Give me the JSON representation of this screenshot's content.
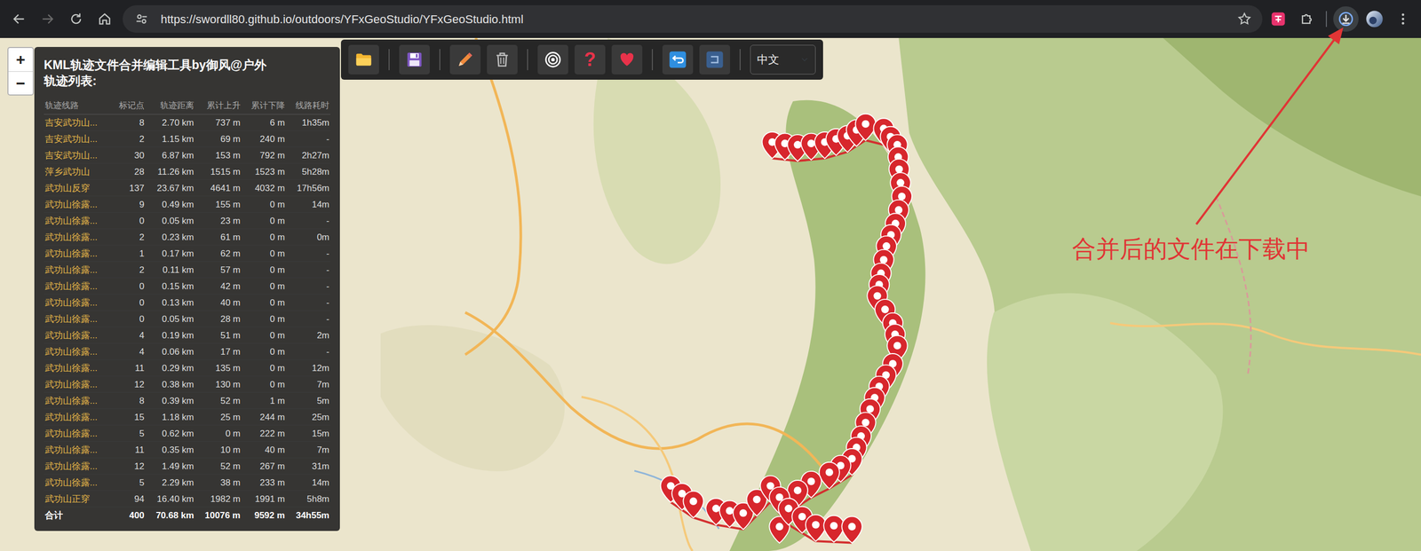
{
  "browser": {
    "url": "https://swordll80.github.io/outdoors/YFxGeoStudio/YFxGeoStudio.html",
    "forward": {
      "disabled": true
    }
  },
  "zoom": {
    "zoom_in": "+",
    "zoom_out": "−"
  },
  "toolbar": {
    "help": "?",
    "language": "中文"
  },
  "panel": {
    "title": "KML轨迹文件合并编辑工具by御风@户外",
    "list_label": "轨迹列表:",
    "columns": [
      "轨迹线路",
      "标记点",
      "轨迹距离",
      "累计上升",
      "累计下降",
      "线路耗时"
    ],
    "rows": [
      [
        "吉安武功山...",
        "8",
        "2.70 km",
        "737 m",
        "6 m",
        "1h35m"
      ],
      [
        "吉安武功山...",
        "2",
        "1.15 km",
        "69 m",
        "240 m",
        "-"
      ],
      [
        "吉安武功山...",
        "30",
        "6.87 km",
        "153 m",
        "792 m",
        "2h27m"
      ],
      [
        "萍乡武功山",
        "28",
        "11.26 km",
        "1515 m",
        "1523 m",
        "5h28m"
      ],
      [
        "武功山反穿",
        "137",
        "23.67 km",
        "4641 m",
        "4032 m",
        "17h56m"
      ],
      [
        "武功山徐露...",
        "9",
        "0.49 km",
        "155 m",
        "0 m",
        "14m"
      ],
      [
        "武功山徐露...",
        "0",
        "0.05 km",
        "23 m",
        "0 m",
        "-"
      ],
      [
        "武功山徐露...",
        "2",
        "0.23 km",
        "61 m",
        "0 m",
        "0m"
      ],
      [
        "武功山徐露...",
        "1",
        "0.17 km",
        "62 m",
        "0 m",
        "-"
      ],
      [
        "武功山徐露...",
        "2",
        "0.11 km",
        "57 m",
        "0 m",
        "-"
      ],
      [
        "武功山徐露...",
        "0",
        "0.15 km",
        "42 m",
        "0 m",
        "-"
      ],
      [
        "武功山徐露...",
        "0",
        "0.13 km",
        "40 m",
        "0 m",
        "-"
      ],
      [
        "武功山徐露...",
        "0",
        "0.05 km",
        "28 m",
        "0 m",
        "-"
      ],
      [
        "武功山徐露...",
        "4",
        "0.19 km",
        "51 m",
        "0 m",
        "2m"
      ],
      [
        "武功山徐露...",
        "4",
        "0.06 km",
        "17 m",
        "0 m",
        "-"
      ],
      [
        "武功山徐露...",
        "11",
        "0.29 km",
        "135 m",
        "0 m",
        "12m"
      ],
      [
        "武功山徐露...",
        "12",
        "0.38 km",
        "130 m",
        "0 m",
        "7m"
      ],
      [
        "武功山徐露...",
        "8",
        "0.39 km",
        "52 m",
        "1 m",
        "5m"
      ],
      [
        "武功山徐露...",
        "15",
        "1.18 km",
        "25 m",
        "244 m",
        "25m"
      ],
      [
        "武功山徐露...",
        "5",
        "0.62 km",
        "0 m",
        "222 m",
        "15m"
      ],
      [
        "武功山徐露...",
        "11",
        "0.35 km",
        "10 m",
        "40 m",
        "7m"
      ],
      [
        "武功山徐露...",
        "12",
        "1.49 km",
        "52 m",
        "267 m",
        "31m"
      ],
      [
        "武功山徐露...",
        "5",
        "2.29 km",
        "38 m",
        "233 m",
        "14m"
      ],
      [
        "武功山正穿",
        "94",
        "16.40 km",
        "1982 m",
        "1991 m",
        "5h8m"
      ]
    ],
    "total": [
      "合计",
      "400",
      "70.68 km",
      "10076 m",
      "9592 m",
      "34h55m"
    ]
  },
  "annotation": {
    "text": "合并后的文件在下载中"
  }
}
